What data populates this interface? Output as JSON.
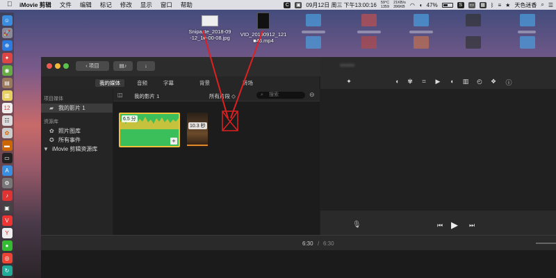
{
  "menubar": {
    "app_name": "iMovie 剪辑",
    "items": [
      "文件",
      "编辑",
      "标记",
      "修改",
      "显示",
      "窗口",
      "帮助"
    ],
    "clock": "09月12日 周三 下午13:00:16",
    "temp": "59°C",
    "rpm": "1359",
    "net_up": "21KB/s",
    "net_down": "396KB",
    "battery_pct": "47%",
    "battery_level": 0.47,
    "user": "天色迷香"
  },
  "desktop": {
    "file1_name_line1": "Snipaste_2018-09",
    "file1_name_line2": "-12_1■-00-08.jpg",
    "file2_name_line1": "VID_20180912_121",
    "file2_name_line2": "■46.mp4"
  },
  "window": {
    "back_button": "项目",
    "tabs": [
      "我的媒体",
      "音频",
      "字幕",
      "背景",
      "转场"
    ],
    "sidebar": {
      "section1": "项目媒体",
      "project_item": "我的影片 1",
      "section2": "资源库",
      "photos_item": "照片图库",
      "events_item": "所有事件",
      "library_item": "iMovie 剪辑资源库"
    },
    "browser": {
      "title": "我的影片 1",
      "filter": "所有片段 ◇",
      "search_placeholder": "搜索",
      "clip1_duration": "6.5 分",
      "clip2_duration": "10.3 秒",
      "add_symbol": "+"
    },
    "timecode_current": "6:30",
    "timecode_sep": "/",
    "timecode_total": "6:30",
    "viewer_blur_title": "■■■■■"
  },
  "colors": {
    "accent": "#4bb34b",
    "arrow": "#e02020",
    "clip_audio": "#d6c23a"
  }
}
